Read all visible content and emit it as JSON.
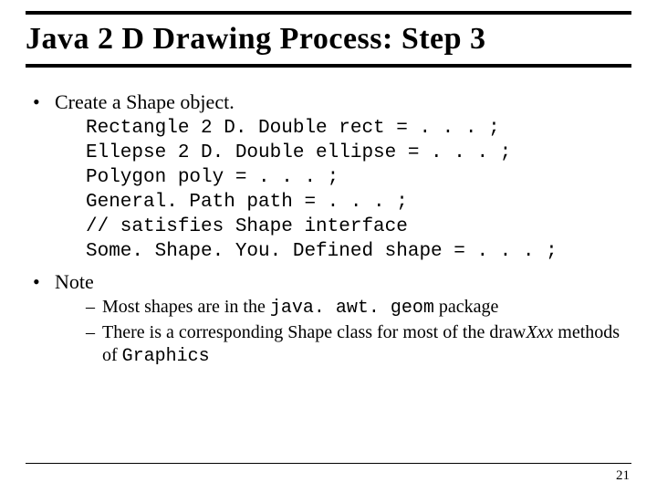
{
  "title": "Java 2 D Drawing Process: Step 3",
  "bullets": {
    "b1": "Create a Shape object.",
    "code1": "Rectangle 2 D. Double rect = . . . ;",
    "code2": "Ellepse 2 D. Double ellipse = . . . ;",
    "code3": "Polygon poly = . . . ;",
    "code4": "General. Path path = . . . ;",
    "code5": "// satisfies Shape interface",
    "code6": "Some. Shape. You. Defined shape = . . . ;",
    "b2": "Note",
    "sub1a": "Most shapes are in the ",
    "sub1b": "java. awt. geom",
    "sub1c": " package",
    "sub2a": "There is a corresponding Shape class for most of the draw",
    "sub2b": "Xxx",
    "sub2c": " methods of ",
    "sub2d": "Graphics"
  },
  "pagenum": "21"
}
